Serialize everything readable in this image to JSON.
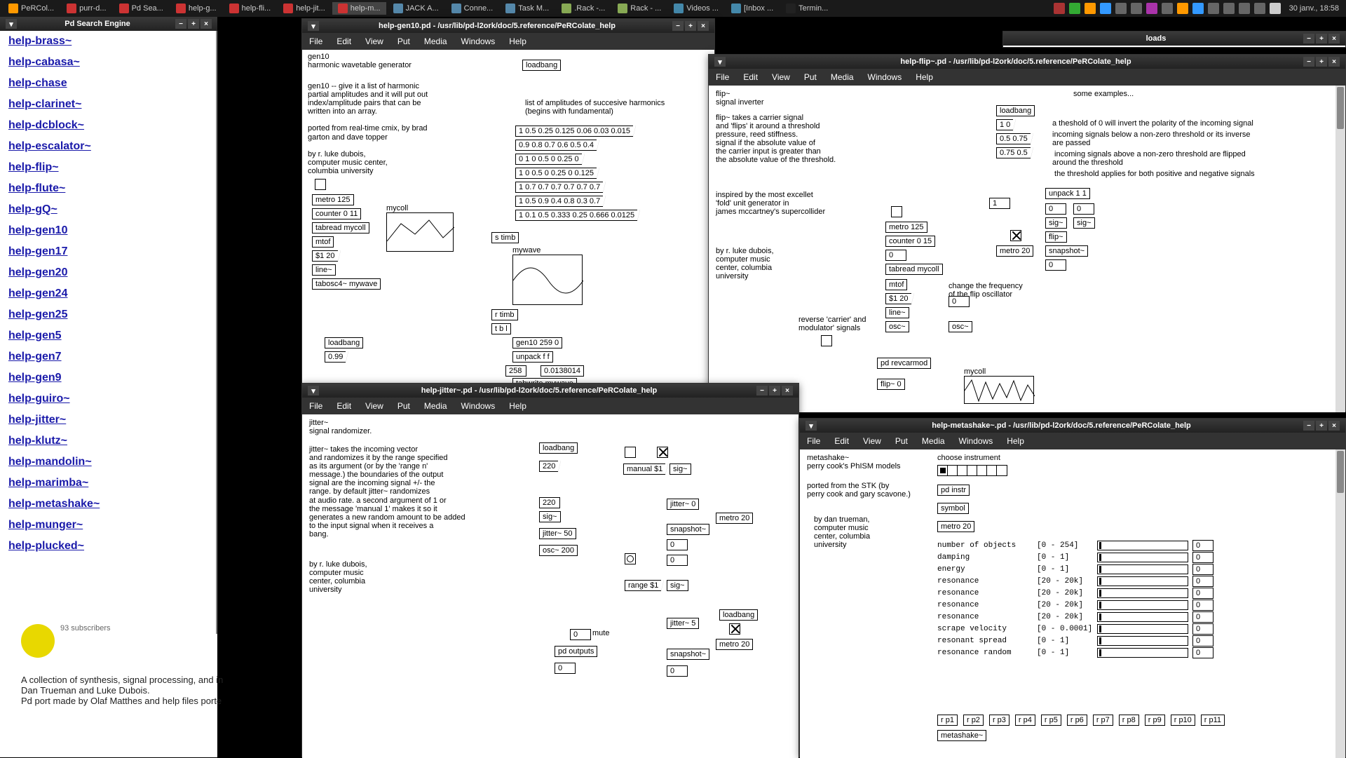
{
  "taskbar": {
    "items": [
      {
        "label": "PeRCol..."
      },
      {
        "label": "purr-d..."
      },
      {
        "label": "Pd Sea..."
      },
      {
        "label": "help-g..."
      },
      {
        "label": "help-fli..."
      },
      {
        "label": "help-jit..."
      },
      {
        "label": "help-m..."
      },
      {
        "label": "JACK A..."
      },
      {
        "label": "Conne..."
      },
      {
        "label": "Task M..."
      },
      {
        "label": ".Rack -..."
      },
      {
        "label": "Rack - ..."
      },
      {
        "label": "Videos ..."
      },
      {
        "label": "[Inbox ..."
      },
      {
        "label": "Termin..."
      }
    ],
    "clock": "30 janv., 18:58"
  },
  "sidebar": {
    "title": "Pd Search Engine",
    "items": [
      "help-brass~",
      "help-cabasa~",
      "help-chase",
      "help-clarinet~",
      "help-dcblock~",
      "help-escalator~",
      "help-flip~",
      "help-flute~",
      "help-gQ~",
      "help-gen10",
      "help-gen17",
      "help-gen20",
      "help-gen24",
      "help-gen25",
      "help-gen5",
      "help-gen7",
      "help-gen9",
      "help-guiro~",
      "help-jitter~",
      "help-klutz~",
      "help-mandolin~",
      "help-marimba~",
      "help-metashake~",
      "help-munger~",
      "help-plucked~"
    ]
  },
  "behind": {
    "subscribers": "93 subscribers",
    "line1": "A collection of synthesis, signal processing, and in",
    "line2": "Dan Trueman and Luke Dubois.",
    "line3": "Pd port made by Olaf Matthes and help files porte"
  },
  "downloads": {
    "title": "loads"
  },
  "win_gen10": {
    "title": "help-gen10.pd - /usr/lib/pd-l2ork/doc/5.reference/PeRColate_help",
    "menu": [
      "File",
      "Edit",
      "View",
      "Put",
      "Media",
      "Windows",
      "Help"
    ],
    "c_title": "gen10\nharmonic wavetable generator",
    "c_desc": "gen10 -- give it a list of harmonic\npartial amplitudes and it will put out\nindex/amplitude pairs that can be\nwritten into an array.\n\nported from real-time cmix, by brad\ngarton and dave topper\n\nby r. luke dubois,\ncomputer music center,\ncolumbia university",
    "c_harm": "list of amplitudes of succesive harmonics\n(begins with fundamental)",
    "loadbang": "loadbang",
    "harmonics": [
      "1 0.5 0.25 0.125 0.06 0.03 0.015",
      "0.9 0.8 0.7 0.6 0.5 0.4",
      "0 1 0 0.5 0 0.25 0",
      "1 0 0.5 0 0.25 0 0.125",
      "1 0.7 0.7 0.7 0.7 0.7 0.7",
      "1 0.5 0.9 0.4 0.8 0.3 0.7",
      "1 0.1 0.5 0.333 0.25 0.666 0.0125"
    ],
    "metro": "metro 125",
    "counter": "counter 0 11",
    "tabread": "tabread mycoll",
    "mtof": "mtof",
    "s1": "$1 20",
    "line": "line~",
    "tabosc": "tabosc4~ mywave",
    "mycoll": "mycoll",
    "mywave": "mywave",
    "stimb": "s timb",
    "rtimb": "r timb",
    "tbl": "t b l",
    "gen10obj": "gen10 259 0",
    "unpack": "unpack f f",
    "n258": "258",
    "n013": "0.0138014",
    "tabwrite": "tabwrite mywave",
    "lb2": "loadbang",
    "n099": "0.99"
  },
  "win_flip": {
    "title": "help-flip~.pd - /usr/lib/pd-l2ork/doc/5.reference/PeRColate_help",
    "menu": [
      "File",
      "Edit",
      "View",
      "Put",
      "Media",
      "Windows",
      "Help"
    ],
    "c_title": "flip~\nsignal inverter",
    "c_desc": "flip~ takes a carrier signal\nand 'flips' it around a threshold\npressure, reed stiffness.\nsignal if the absolute value of\nthe carrier input is greater than\nthe absolute value of the threshold.",
    "c_insp": "inspired by the most excellet\n'fold' unit generator in\njames mccartney's supercollider",
    "c_author": "by r. luke dubois,\ncomputer music\ncenter, columbia\nuniversity",
    "c_examples": "some examples...",
    "c_thresh": "a theshold of 0 will invert the polarity of the incoming signal",
    "c_below": "incoming signals below a non-zero threshold or its inverse\nare passed",
    "c_above": " incoming signals above a non-zero threshold are flipped\naround the threshold",
    "c_both": " the threshold applies for both positive and negative signals",
    "c_change": "change the frequency\nof the flip oscillator",
    "c_reverse": "reverse 'carrier' and\nmodulator' signals",
    "loadbang": "loadbang",
    "metro": "metro 125",
    "metro20": "metro 20",
    "counter": "counter 0 15",
    "tabread": "tabread mycoll",
    "mtof": "mtof",
    "s1": "$1 20",
    "line": "line~",
    "osc": "osc~",
    "osc2": "osc~",
    "flip0": "flip~ 0",
    "snapshot": "snapshot~",
    "sig": "sig~",
    "flip2": "flip~",
    "unpack11": "unpack 1 1",
    "revcarmod": "pd revcarmod",
    "mycoll": "mycoll",
    "n10": "1 0",
    "n0575": "0.5 0.75",
    "n075": "0.75 0.5",
    "n1": "1",
    "n0_1": "0",
    "n0_2": "0",
    "n0_3": "0",
    "n0_4": "0",
    "n0_5": "0",
    "n20_333": "0"
  },
  "win_jitter": {
    "title": "help-jitter~.pd - /usr/lib/pd-l2ork/doc/5.reference/PeRColate_help",
    "menu": [
      "File",
      "Edit",
      "View",
      "Put",
      "Media",
      "Windows",
      "Help"
    ],
    "c_title": "jitter~\nsignal randomizer.",
    "c_desc": "jitter~ takes the incoming vector\nand randomizes it by the range specified\nas its argument (or by the 'range n'\nmessage.) the boundaries of the output\nsignal are the incoming signal +/- the\nrange. by default jitter~ randomizes\nat audio rate. a second argument of 1 or\nthe message 'manual 1' makes it so it\ngenerates a new random amount to be added\nto the input signal when it receives a\nbang.",
    "c_author": "by r. luke dubois,\ncomputer music\ncenter, columbia\nuniversity",
    "loadbang": "loadbang",
    "n220_1": "220",
    "n220_2": "220",
    "sig": "sig~",
    "jitter50": "jitter~ 50",
    "osc200": "osc~ 200",
    "manual": "manual $1",
    "sig2": "sig~",
    "jitter0": "jitter~ 0",
    "snapshot": "snapshot~",
    "metro20": "metro 20",
    "jitter5": "jitter~ 5",
    "snapshot2": "snapshot~",
    "metro20_2": "metro 20",
    "mute": "mute",
    "range": "range $1",
    "outputs": "pd outputs",
    "n0_1": "0",
    "n0_2": "0",
    "n0_3": "0",
    "n0_4": "0",
    "n0_5": "0",
    "lb2": "loadbang"
  },
  "win_meta": {
    "title": "help-metashake~.pd - /usr/lib/pd-l2ork/doc/5.reference/PeRColate_help",
    "menu": [
      "File",
      "Edit",
      "View",
      "Put",
      "Media",
      "Windows",
      "Help"
    ],
    "c_title": "metashake~\nperry cook's PhISM models",
    "c_ported": "ported from the STK (by\nperry cook and gary scavone.)",
    "c_author": "by dan trueman,\ncomputer music\ncenter, columbia\nuniversity",
    "c_choose": "choose instrument",
    "instr": "pd instr",
    "symbol": "symbol",
    "metro20": "metro 20",
    "params": [
      {
        "label": "number of objects",
        "range": "[0 - 254]",
        "val": "0"
      },
      {
        "label": "damping",
        "range": "[0 - 1]",
        "val": "0"
      },
      {
        "label": "energy",
        "range": "[0 - 1]",
        "val": "0"
      },
      {
        "label": "resonance",
        "range": "[20 - 20k]",
        "val": "0"
      },
      {
        "label": "resonance",
        "range": "[20 - 20k]",
        "val": "0"
      },
      {
        "label": "resonance",
        "range": "[20 - 20k]",
        "val": "0"
      },
      {
        "label": "resonance",
        "range": "[20 - 20k]",
        "val": "0"
      },
      {
        "label": "scrape velocity",
        "range": "[0 - 0.0001]",
        "val": "0"
      },
      {
        "label": "resonant spread",
        "range": "[0 - 1]",
        "val": "0"
      },
      {
        "label": "resonance random",
        "range": "[0 - 1]",
        "val": "0"
      }
    ],
    "routes": [
      "r p1",
      "r p2",
      "r p3",
      "r p4",
      "r p5",
      "r p6",
      "r p7",
      "r p8",
      "r p9",
      "r p10",
      "r p11"
    ],
    "metashake": "metashake~"
  }
}
